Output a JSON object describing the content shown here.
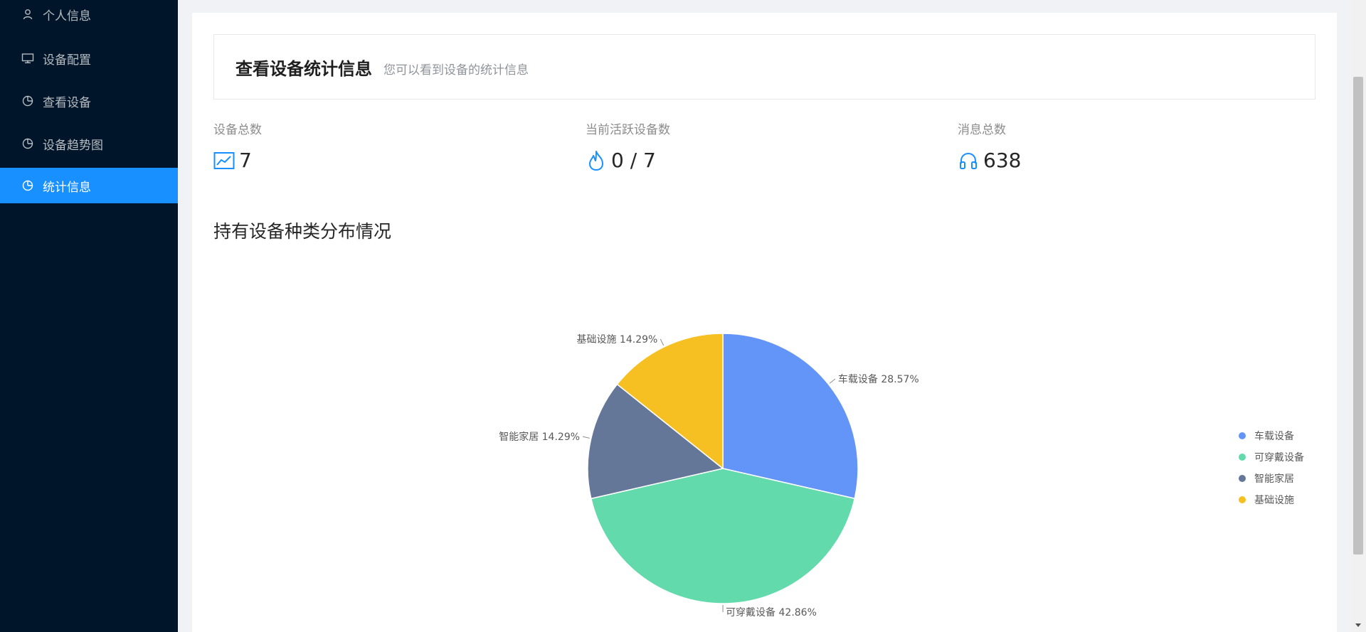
{
  "sidebar": {
    "items": [
      {
        "label": "个人信息",
        "icon": "user-icon",
        "active": false
      },
      {
        "label": "设备配置",
        "icon": "monitor-icon",
        "active": false
      },
      {
        "label": "查看设备",
        "icon": "pie-chart-icon",
        "active": false
      },
      {
        "label": "设备趋势图",
        "icon": "pie-chart-icon",
        "active": false
      },
      {
        "label": "统计信息",
        "icon": "pie-chart-icon",
        "active": true
      }
    ]
  },
  "header": {
    "title": "查看设备统计信息",
    "subtitle": "您可以看到设备的统计信息"
  },
  "stats": [
    {
      "label": "设备总数",
      "value": "7",
      "icon": "line-chart-icon"
    },
    {
      "label": "当前活跃设备数",
      "value": "0 / 7",
      "icon": "fire-icon"
    },
    {
      "label": "消息总数",
      "value": "638",
      "icon": "headphones-icon"
    }
  ],
  "section": {
    "title": "持有设备种类分布情况"
  },
  "colors": {
    "sidebar_bg": "#001529",
    "accent": "#1890ff",
    "slice_1": "#6395f9",
    "slice_2": "#62daab",
    "slice_3": "#657798",
    "slice_4": "#f6c022"
  },
  "chart_data": {
    "type": "pie",
    "title": "",
    "legend_position": "right",
    "categories": [
      "车载设备",
      "可穿戴设备",
      "智能家居",
      "基础设施"
    ],
    "values": [
      28.57,
      42.86,
      14.29,
      14.29
    ],
    "labels": [
      "车载设备 28.57%",
      "可穿戴设备 42.86%",
      "智能家居 14.29%",
      "基础设施 14.29%"
    ],
    "colors": [
      "#6395f9",
      "#62daab",
      "#657798",
      "#f6c022"
    ]
  }
}
